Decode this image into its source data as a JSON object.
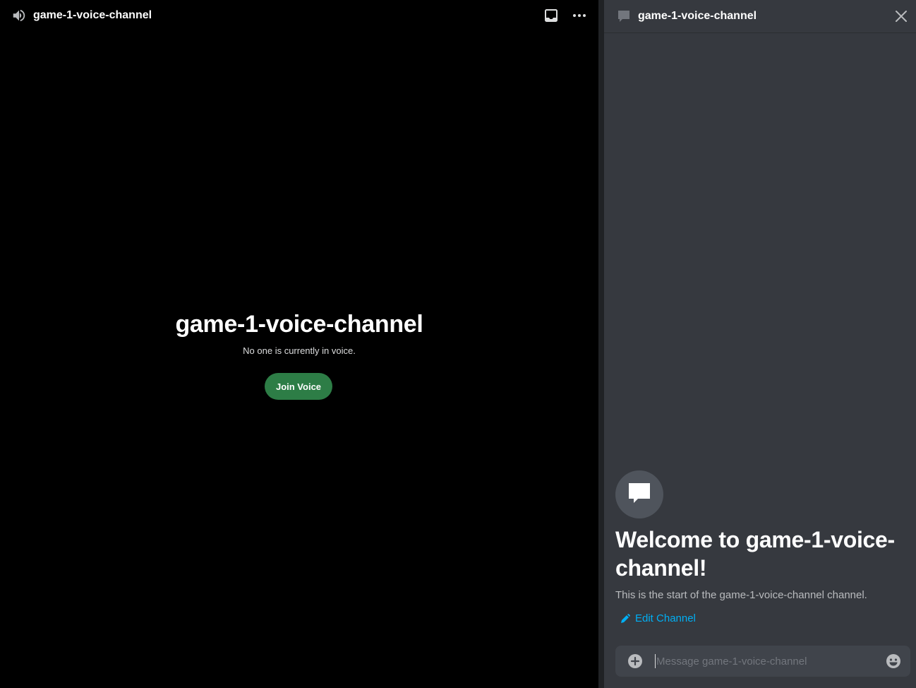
{
  "voice": {
    "header_title": "game-1-voice-channel",
    "center_title": "game-1-voice-channel",
    "status_text": "No one is currently in voice.",
    "join_button_label": "Join Voice",
    "join_button_color": "#2d7d46",
    "icons": {
      "speaker": "speaker-icon",
      "inbox": "inbox-icon",
      "more": "more-options-icon"
    }
  },
  "chat": {
    "header_title": "game-1-voice-channel",
    "welcome_heading": "Welcome to game-1-voice-channel!",
    "welcome_description": "This is the start of the game-1-voice-channel channel.",
    "edit_channel_label": "Edit Channel",
    "link_color": "#00aff4",
    "composer": {
      "placeholder": "Message game-1-voice-channel",
      "value": ""
    },
    "icons": {
      "chat": "chat-bubble-icon",
      "close": "close-icon",
      "avatar": "chat-bubble-icon",
      "pencil": "pencil-icon",
      "add": "add-circle-icon",
      "emoji": "emoji-icon"
    }
  }
}
